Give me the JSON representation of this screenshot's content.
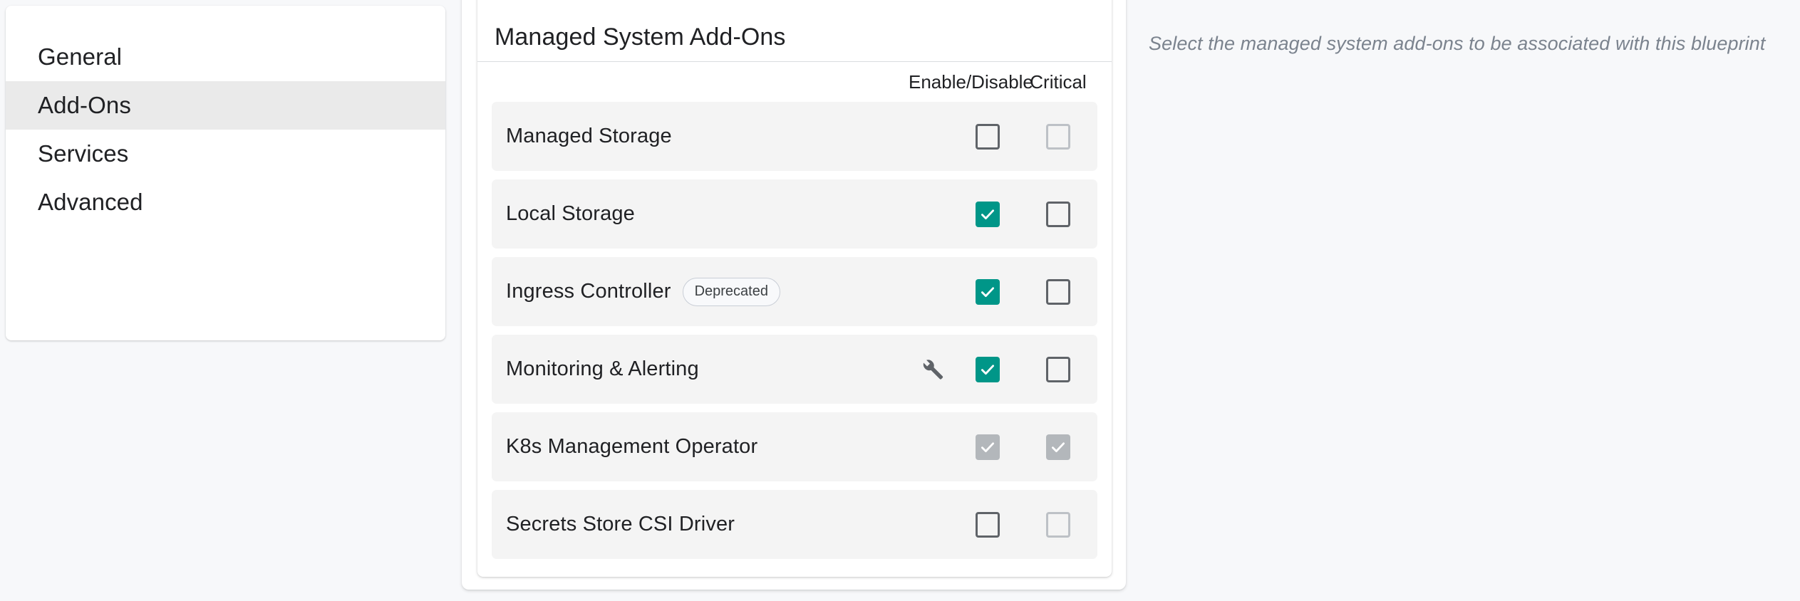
{
  "sidebar": {
    "items": [
      {
        "label": "General",
        "active": false
      },
      {
        "label": "Add-Ons",
        "active": true
      },
      {
        "label": "Services",
        "active": false
      },
      {
        "label": "Advanced",
        "active": false
      }
    ]
  },
  "card": {
    "title": "Managed System Add-Ons",
    "columns": {
      "enable": "Enable/Disable",
      "critical": "Critical"
    },
    "rows": [
      {
        "label": "Managed Storage",
        "badge": null,
        "tool_icon": null,
        "enable": {
          "state": "unchecked",
          "disabled": false
        },
        "critical": {
          "state": "unchecked",
          "disabled": true
        }
      },
      {
        "label": "Local Storage",
        "badge": null,
        "tool_icon": null,
        "enable": {
          "state": "checked",
          "disabled": false
        },
        "critical": {
          "state": "unchecked",
          "disabled": false
        }
      },
      {
        "label": "Ingress Controller",
        "badge": "Deprecated",
        "tool_icon": null,
        "enable": {
          "state": "checked",
          "disabled": false
        },
        "critical": {
          "state": "unchecked",
          "disabled": false
        }
      },
      {
        "label": "Monitoring & Alerting",
        "badge": null,
        "tool_icon": "wrench-icon",
        "enable": {
          "state": "checked",
          "disabled": false
        },
        "critical": {
          "state": "unchecked",
          "disabled": false
        }
      },
      {
        "label": "K8s Management Operator",
        "badge": null,
        "tool_icon": null,
        "enable": {
          "state": "checked",
          "disabled": true
        },
        "critical": {
          "state": "checked",
          "disabled": true
        }
      },
      {
        "label": "Secrets Store CSI Driver",
        "badge": null,
        "tool_icon": null,
        "enable": {
          "state": "unchecked",
          "disabled": false
        },
        "critical": {
          "state": "unchecked",
          "disabled": true
        }
      }
    ]
  },
  "helper": {
    "text": "Select the managed system add-ons to be associated with this blueprint"
  },
  "colors": {
    "accent_teal": "#009688",
    "row_background": "#f4f4f4",
    "active_nav_background": "#eaeaea",
    "page_background": "#f7f8fa",
    "disabled_grey": "#b3b7bb",
    "helper_text": "#7b838e"
  }
}
